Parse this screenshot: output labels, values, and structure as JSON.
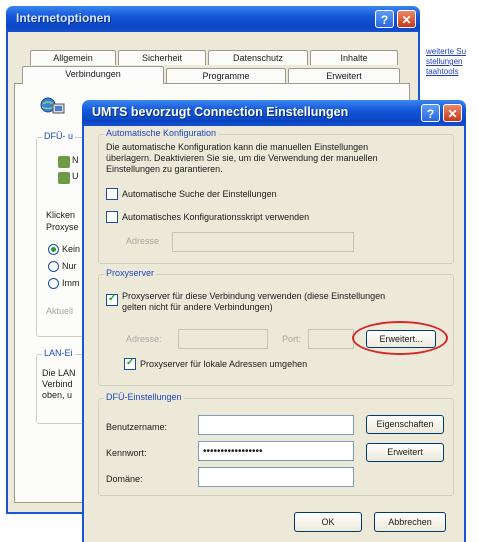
{
  "background_window": {
    "title": "Internetoptionen",
    "tabs_row1": [
      "Allgemein",
      "Sicherheit",
      "Datenschutz",
      "Inhalte"
    ],
    "tabs_row2": [
      "Verbindungen",
      "Programme",
      "Erweitert"
    ],
    "partial_texts": {
      "dfu_label": "DFÜ- u",
      "conn1": "N",
      "conn2": "U",
      "klicken": "Klicken",
      "proxy": "Proxyse",
      "radio1": "Kein",
      "radio2": "Nur",
      "radio3": "Imm",
      "aktuell": "Aktuell",
      "lan_label": "LAN-Ei",
      "lan1": "Die LAN",
      "lan2": "Verbind",
      "lan3": "oben, u"
    },
    "side_links": [
      "weiterte Su",
      "stellungen",
      "taahtools"
    ]
  },
  "dialog": {
    "title": "UMTS bevorzugt Connection Einstellungen",
    "auto_config": {
      "label": "Automatische Konfiguration",
      "description_line1": "Die automatische Konfiguration kann die manuellen Einstellungen",
      "description_line2": "überlagern. Deaktivieren Sie sie, um die Verwendung der manuellen",
      "description_line3": "Einstellungen zu garantieren.",
      "auto_detect_label": "Automatische Suche der Einstellungen",
      "auto_script_label": "Automatisches Konfigurationsskript verwenden",
      "address_label": "Adresse"
    },
    "proxy": {
      "label": "Proxyserver",
      "use_proxy_line1": "Proxyserver für diese Verbindung verwenden (diese Einstellungen",
      "use_proxy_line2": "gelten nicht für andere Verbindungen)",
      "address_label": "Adresse:",
      "port_label": "Port:",
      "advanced_button": "Erweitert...",
      "bypass_label": "Proxyserver für lokale Adressen umgehen"
    },
    "dialup": {
      "label": "DFÜ-Einstellungen",
      "username_label": "Benutzername:",
      "password_label": "Kennwort:",
      "password_value": "•••••••••••••••••",
      "domain_label": "Domäne:",
      "properties_button": "Eigenschaften",
      "advanced_button": "Erweitert"
    },
    "ok_button": "OK",
    "cancel_button": "Abbrechen"
  },
  "colors": {
    "titlebar": "#1457d8",
    "dialog_face": "#ece9d8",
    "group_label": "#1d46c4",
    "highlight_circle": "#d42a2a"
  },
  "icons": [
    "help-icon",
    "close-icon",
    "network-icon",
    "connection-icon"
  ]
}
